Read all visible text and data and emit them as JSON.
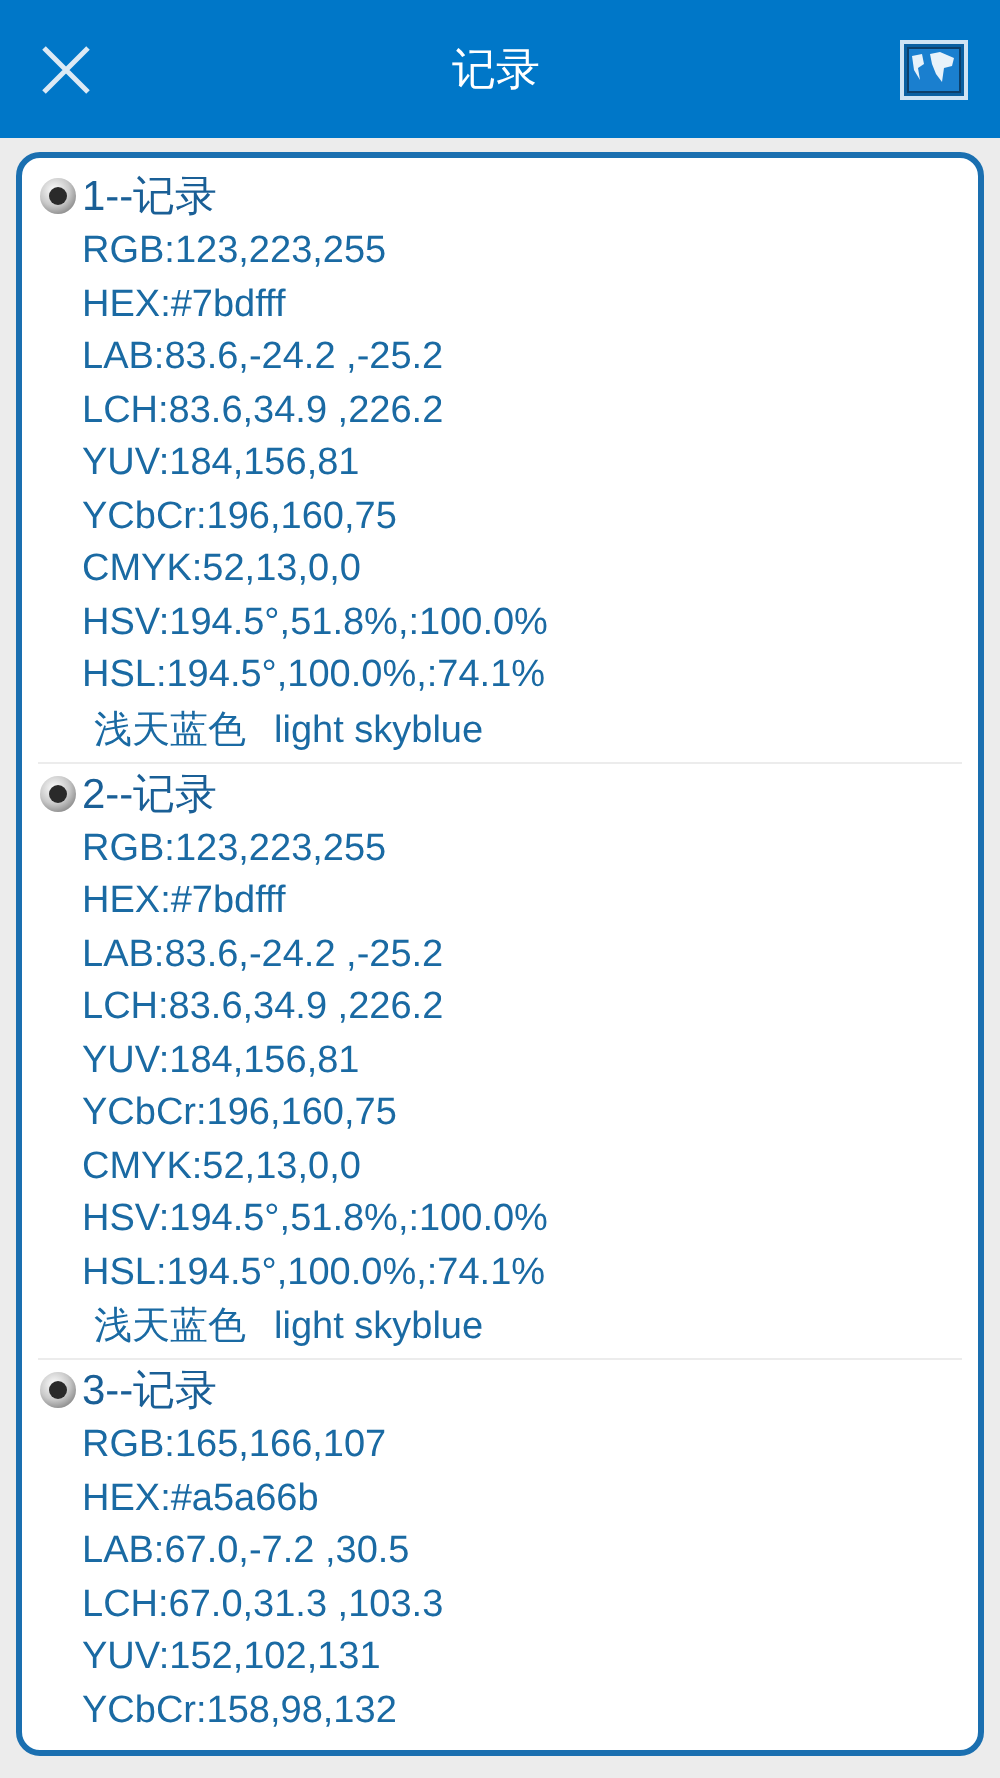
{
  "header": {
    "title": "记录"
  },
  "records": [
    {
      "title": "1--记录",
      "lines": [
        "RGB:123,223,255",
        "HEX:#7bdfff",
        "LAB:83.6,-24.2 ,-25.2",
        "LCH:83.6,34.9 ,226.2",
        "YUV:184,156,81",
        "YCbCr:196,160,75",
        "CMYK:52,13,0,0",
        "HSV:194.5°,51.8%,:100.0%",
        "HSL:194.5°,100.0%,:74.1%"
      ],
      "name_zh": "浅天蓝色",
      "name_en": "light skyblue"
    },
    {
      "title": "2--记录",
      "lines": [
        "RGB:123,223,255",
        "HEX:#7bdfff",
        "LAB:83.6,-24.2 ,-25.2",
        "LCH:83.6,34.9 ,226.2",
        "YUV:184,156,81",
        "YCbCr:196,160,75",
        "CMYK:52,13,0,0",
        "HSV:194.5°,51.8%,:100.0%",
        "HSL:194.5°,100.0%,:74.1%"
      ],
      "name_zh": "浅天蓝色",
      "name_en": "light skyblue"
    },
    {
      "title": "3--记录",
      "lines": [
        "RGB:165,166,107",
        "HEX:#a5a66b",
        "LAB:67.0,-7.2 ,30.5",
        "LCH:67.0,31.3 ,103.3",
        "YUV:152,102,131",
        "YCbCr:158,98,132"
      ]
    }
  ]
}
